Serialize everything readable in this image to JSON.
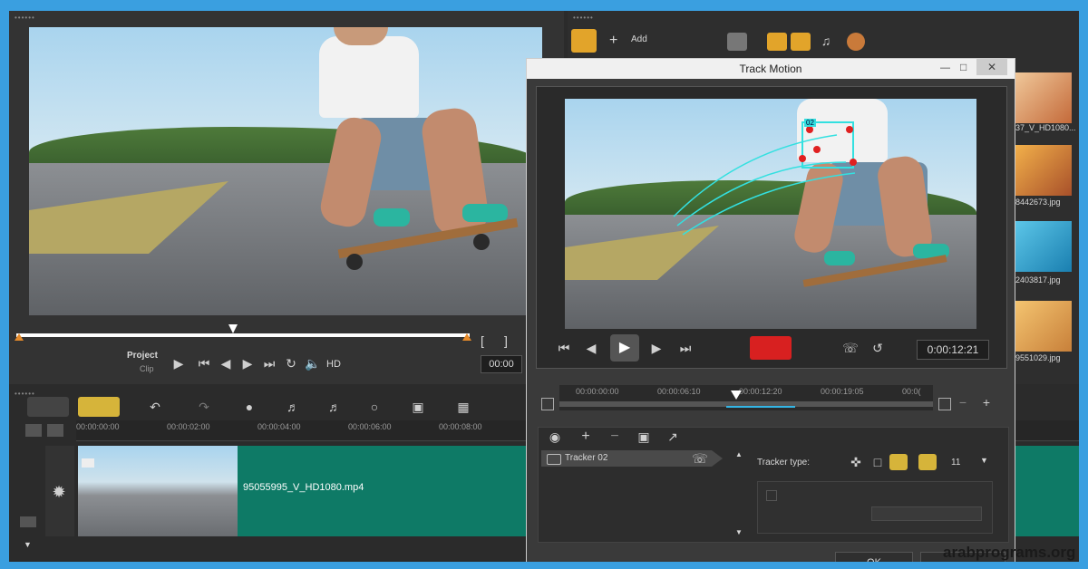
{
  "preview": {
    "project_label": "Project",
    "clip_label": "Clip",
    "timecode": "00:00",
    "hd_label": "HD",
    "bracket_in": "[",
    "bracket_out": "]"
  },
  "library": {
    "add_label": "Add",
    "thumbs": [
      {
        "label": "37_V_HD1080..."
      },
      {
        "label": "8442673.jpg"
      },
      {
        "label": "2403817.jpg"
      },
      {
        "label": "9551029.jpg"
      }
    ]
  },
  "timeline": {
    "ticks": [
      "00:00:00:00",
      "00:00:02:00",
      "00:00:04:00",
      "00:00:06:00",
      "00:00:08:00"
    ],
    "clip_name": "95055995_V_HD1080.mp4"
  },
  "dialog": {
    "title": "Track Motion",
    "timecode": "0:00:12:21",
    "ticks": [
      "00:00:00:00",
      "00:00:06:10",
      "00:00:12:20",
      "00:00:19:05",
      "00:0("
    ],
    "tracker_name": "Tracker 02",
    "tracker_type_label": "Tracker type:",
    "size_value": "11",
    "ok_label": "OK",
    "tracker_box_label": "02"
  },
  "watermark": "arabprograms.org",
  "colors": {
    "accent": "#0e7a66",
    "record": "#d82020",
    "timeline_clip": "#0e7a66"
  }
}
